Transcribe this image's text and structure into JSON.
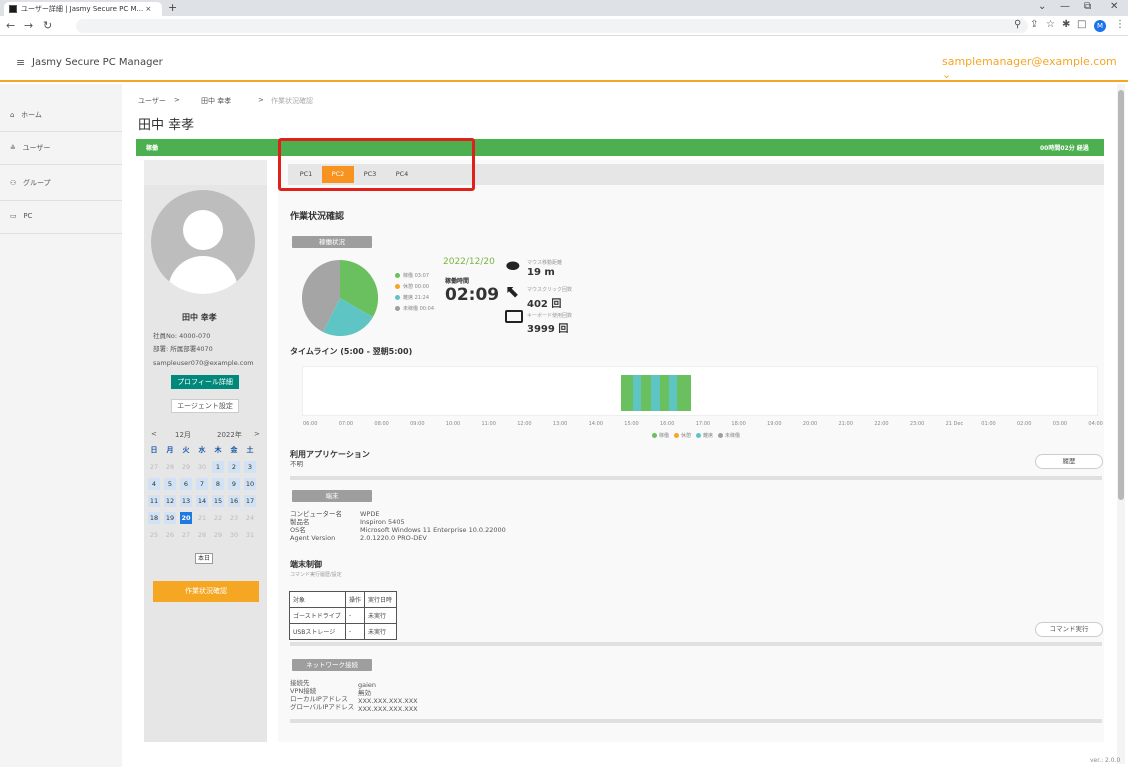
{
  "browser": {
    "tab_title": "ユーザー詳細 | Jasmy Secure PC M... ×",
    "new_tab": "+",
    "avatar_letter": "M",
    "win_min": "—",
    "win_max": "⧉",
    "win_close": "✕",
    "chevron": "⌄"
  },
  "app": {
    "title": "Jasmy Secure PC Manager",
    "user_email": "samplemanager@example.com ⌄",
    "version": "ver.: 2.0.0"
  },
  "sidebar": {
    "items": [
      {
        "icon": "home-icon",
        "label": "ホーム"
      },
      {
        "icon": "user-icon",
        "label": "ユーザー"
      },
      {
        "icon": "group-icon",
        "label": "グループ"
      },
      {
        "icon": "pc-icon",
        "label": "PC"
      }
    ]
  },
  "breadcrumb": {
    "items": [
      "ユーザー",
      "田中 幸孝",
      "作業状況確認"
    ],
    "sep": ">"
  },
  "page": {
    "title": "田中 幸孝",
    "status_left": "稼働",
    "status_right": "00時間02分 経過"
  },
  "profile": {
    "name": "田中 幸孝",
    "employee_no": "社員No: 4000-070",
    "department": "部署: 所属部署4070",
    "email": "sampleuser070@example.com",
    "profile_button": "プロフィール詳細",
    "agent_button": "エージェント設定",
    "work_button": "作業状況確認"
  },
  "calendar": {
    "prev": "<",
    "month": "12月",
    "year": "2022年",
    "next": ">",
    "weekdays": [
      "日",
      "月",
      "火",
      "水",
      "木",
      "金",
      "土"
    ],
    "today_button": "本日",
    "weeks": [
      [
        "27",
        "28",
        "29",
        "30",
        "1",
        "2",
        "3"
      ],
      [
        "4",
        "5",
        "6",
        "7",
        "8",
        "9",
        "10"
      ],
      [
        "11",
        "12",
        "13",
        "14",
        "15",
        "16",
        "17"
      ],
      [
        "18",
        "19",
        "20",
        "21",
        "22",
        "23",
        "24"
      ],
      [
        "25",
        "26",
        "27",
        "28",
        "29",
        "30",
        "31"
      ]
    ],
    "selected": "20"
  },
  "pc_tabs": [
    "PC1",
    "PC2",
    "PC3",
    "PC4"
  ],
  "active_pc_tab": "PC2",
  "work": {
    "heading": "作業状況確認",
    "section_status": "稼働状況",
    "date": "2022/12/20",
    "runtime_label": "稼働時間",
    "runtime": "02:09",
    "legend": [
      {
        "label": "稼働",
        "value": "03:07",
        "color": "#6abf5e"
      },
      {
        "label": "休憩",
        "value": "00:00",
        "color": "#f5a623"
      },
      {
        "label": "離席",
        "value": "21:24",
        "color": "#5fc4c4"
      },
      {
        "label": "未稼働",
        "value": "00:04",
        "color": "#9e9e9e"
      }
    ],
    "mouse_move_label": "マウス移動距離",
    "mouse_move": "19 m",
    "mouse_click_label": "マウスクリック回数",
    "mouse_click": "402 回",
    "keyboard_label": "キーボード使用回数",
    "keyboard": "3999 回"
  },
  "timeline": {
    "title": "タイムライン (5:00 - 翌朝5:00)",
    "ticks": [
      "06:00",
      "07:00",
      "08:00",
      "09:00",
      "10:00",
      "11:00",
      "12:00",
      "13:00",
      "14:00",
      "15:00",
      "16:00",
      "17:00",
      "18:00",
      "19:00",
      "20:00",
      "21:00",
      "22:00",
      "23:00",
      "21 Dec",
      "01:00",
      "02:00",
      "03:00",
      "04:00"
    ],
    "legend": [
      {
        "label": "稼働",
        "color": "#6abf5e"
      },
      {
        "label": "休憩",
        "color": "#f5a623"
      },
      {
        "label": "離席",
        "color": "#5fc4c4"
      },
      {
        "label": "未稼働",
        "color": "#9e9e9e"
      }
    ]
  },
  "apps": {
    "heading": "利用アプリケーション",
    "value": "不明",
    "history_button": "履歴"
  },
  "terminal": {
    "section": "端末",
    "rows": [
      {
        "key": "コンピューター名",
        "value": "WPDE"
      },
      {
        "key": "製品名",
        "value": "Inspiron 5405"
      },
      {
        "key": "OS名",
        "value": "Microsoft Windows 11 Enterprise 10.0.22000"
      },
      {
        "key": "Agent Version",
        "value": "2.0.1220.0 PRO-DEV"
      }
    ]
  },
  "control": {
    "heading": "端末制御",
    "subheading": "コマンド実行履歴/設定",
    "columns": [
      "対象",
      "操作",
      "実行日時"
    ],
    "rows": [
      [
        "ゴーストドライブ",
        "-",
        "未実行"
      ],
      [
        "USBストレージ",
        "-",
        "未実行"
      ]
    ],
    "command_button": "コマンド実行"
  },
  "network": {
    "section": "ネットワーク接続",
    "rows": [
      {
        "key": "接続先",
        "value": "gaien"
      },
      {
        "key": "VPN接続",
        "value": "無効"
      },
      {
        "key": "ローカルIPアドレス",
        "value": "XXX.XXX.XXX.XXX"
      },
      {
        "key": "グローバルIPアドレス",
        "value": "XXX.XXX.XXX.XXX"
      }
    ]
  }
}
